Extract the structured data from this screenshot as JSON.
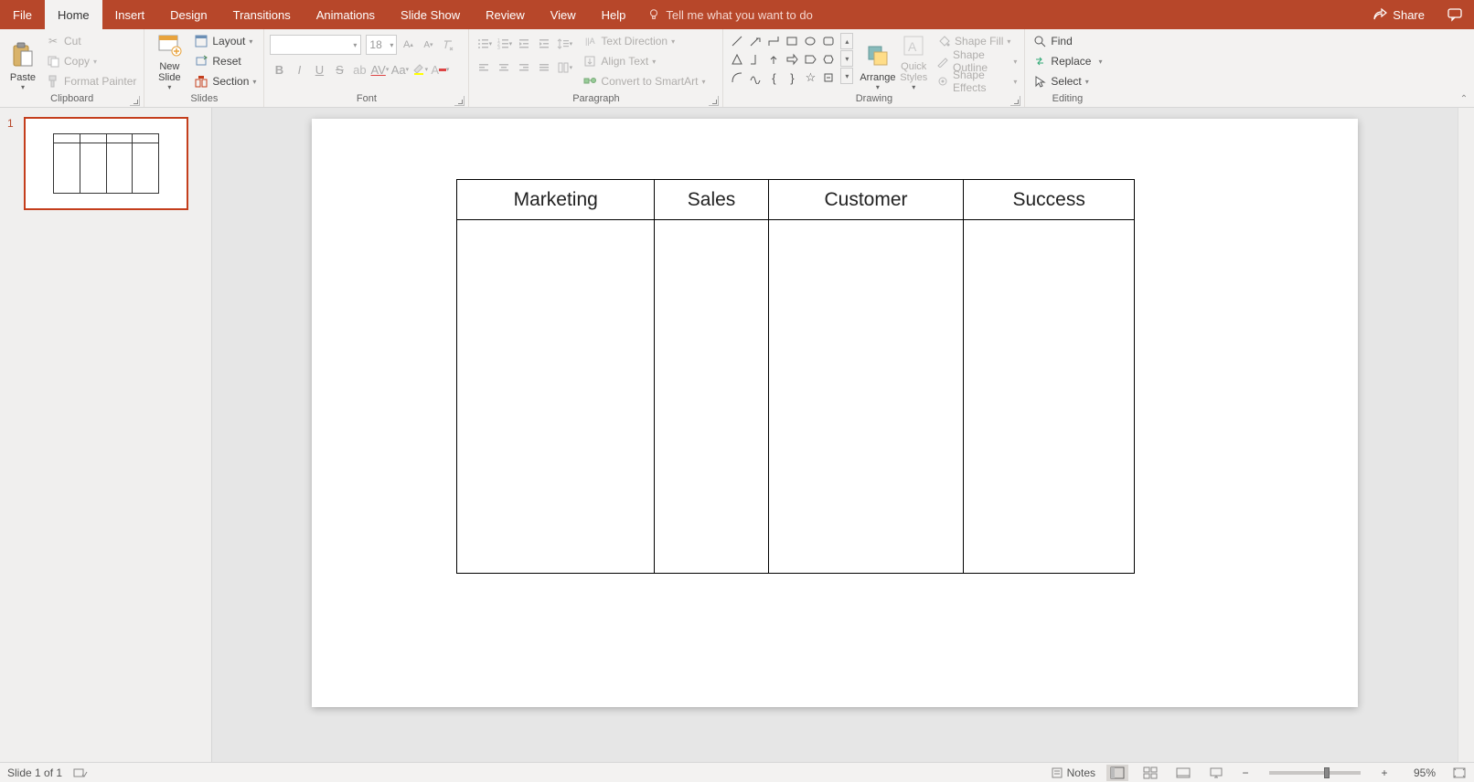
{
  "menu": {
    "tabs": [
      "File",
      "Home",
      "Insert",
      "Design",
      "Transitions",
      "Animations",
      "Slide Show",
      "Review",
      "View",
      "Help"
    ],
    "active": "Home",
    "tellme": "Tell me what you want to do",
    "share": "Share"
  },
  "ribbon": {
    "clipboard": {
      "paste": "Paste",
      "cut": "Cut",
      "copy": "Copy",
      "format_painter": "Format Painter",
      "label": "Clipboard"
    },
    "slides": {
      "new_slide": "New\nSlide",
      "layout": "Layout",
      "reset": "Reset",
      "section": "Section",
      "label": "Slides"
    },
    "font": {
      "name_placeholder": "",
      "size": "18",
      "label": "Font"
    },
    "paragraph": {
      "text_direction": "Text Direction",
      "align_text": "Align Text",
      "convert_smartart": "Convert to SmartArt",
      "label": "Paragraph"
    },
    "drawing": {
      "arrange": "Arrange",
      "quick_styles": "Quick\nStyles",
      "shape_fill": "Shape Fill",
      "shape_outline": "Shape Outline",
      "shape_effects": "Shape Effects",
      "label": "Drawing"
    },
    "editing": {
      "find": "Find",
      "replace": "Replace",
      "select": "Select",
      "label": "Editing"
    }
  },
  "thumbs": {
    "slide1_num": "1"
  },
  "slide": {
    "headers": [
      "Marketing",
      "Sales",
      "Customer",
      "Success"
    ]
  },
  "status": {
    "slide_info": "Slide 1 of 1",
    "notes": "Notes",
    "zoom": "95%"
  }
}
